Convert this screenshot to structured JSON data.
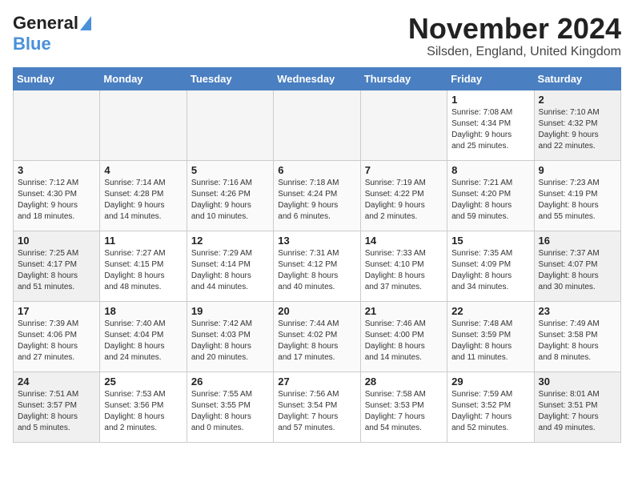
{
  "logo": {
    "line1": "General",
    "line2": "Blue"
  },
  "title": "November 2024",
  "location": "Silsden, England, United Kingdom",
  "days_of_week": [
    "Sunday",
    "Monday",
    "Tuesday",
    "Wednesday",
    "Thursday",
    "Friday",
    "Saturday"
  ],
  "weeks": [
    [
      {
        "day": "",
        "info": "",
        "empty": true
      },
      {
        "day": "",
        "info": "",
        "empty": true
      },
      {
        "day": "",
        "info": "",
        "empty": true
      },
      {
        "day": "",
        "info": "",
        "empty": true
      },
      {
        "day": "",
        "info": "",
        "empty": true
      },
      {
        "day": "1",
        "info": "Sunrise: 7:08 AM\nSunset: 4:34 PM\nDaylight: 9 hours\nand 25 minutes."
      },
      {
        "day": "2",
        "info": "Sunrise: 7:10 AM\nSunset: 4:32 PM\nDaylight: 9 hours\nand 22 minutes."
      }
    ],
    [
      {
        "day": "3",
        "info": "Sunrise: 7:12 AM\nSunset: 4:30 PM\nDaylight: 9 hours\nand 18 minutes."
      },
      {
        "day": "4",
        "info": "Sunrise: 7:14 AM\nSunset: 4:28 PM\nDaylight: 9 hours\nand 14 minutes."
      },
      {
        "day": "5",
        "info": "Sunrise: 7:16 AM\nSunset: 4:26 PM\nDaylight: 9 hours\nand 10 minutes."
      },
      {
        "day": "6",
        "info": "Sunrise: 7:18 AM\nSunset: 4:24 PM\nDaylight: 9 hours\nand 6 minutes."
      },
      {
        "day": "7",
        "info": "Sunrise: 7:19 AM\nSunset: 4:22 PM\nDaylight: 9 hours\nand 2 minutes."
      },
      {
        "day": "8",
        "info": "Sunrise: 7:21 AM\nSunset: 4:20 PM\nDaylight: 8 hours\nand 59 minutes."
      },
      {
        "day": "9",
        "info": "Sunrise: 7:23 AM\nSunset: 4:19 PM\nDaylight: 8 hours\nand 55 minutes."
      }
    ],
    [
      {
        "day": "10",
        "info": "Sunrise: 7:25 AM\nSunset: 4:17 PM\nDaylight: 8 hours\nand 51 minutes."
      },
      {
        "day": "11",
        "info": "Sunrise: 7:27 AM\nSunset: 4:15 PM\nDaylight: 8 hours\nand 48 minutes."
      },
      {
        "day": "12",
        "info": "Sunrise: 7:29 AM\nSunset: 4:14 PM\nDaylight: 8 hours\nand 44 minutes."
      },
      {
        "day": "13",
        "info": "Sunrise: 7:31 AM\nSunset: 4:12 PM\nDaylight: 8 hours\nand 40 minutes."
      },
      {
        "day": "14",
        "info": "Sunrise: 7:33 AM\nSunset: 4:10 PM\nDaylight: 8 hours\nand 37 minutes."
      },
      {
        "day": "15",
        "info": "Sunrise: 7:35 AM\nSunset: 4:09 PM\nDaylight: 8 hours\nand 34 minutes."
      },
      {
        "day": "16",
        "info": "Sunrise: 7:37 AM\nSunset: 4:07 PM\nDaylight: 8 hours\nand 30 minutes."
      }
    ],
    [
      {
        "day": "17",
        "info": "Sunrise: 7:39 AM\nSunset: 4:06 PM\nDaylight: 8 hours\nand 27 minutes."
      },
      {
        "day": "18",
        "info": "Sunrise: 7:40 AM\nSunset: 4:04 PM\nDaylight: 8 hours\nand 24 minutes."
      },
      {
        "day": "19",
        "info": "Sunrise: 7:42 AM\nSunset: 4:03 PM\nDaylight: 8 hours\nand 20 minutes."
      },
      {
        "day": "20",
        "info": "Sunrise: 7:44 AM\nSunset: 4:02 PM\nDaylight: 8 hours\nand 17 minutes."
      },
      {
        "day": "21",
        "info": "Sunrise: 7:46 AM\nSunset: 4:00 PM\nDaylight: 8 hours\nand 14 minutes."
      },
      {
        "day": "22",
        "info": "Sunrise: 7:48 AM\nSunset: 3:59 PM\nDaylight: 8 hours\nand 11 minutes."
      },
      {
        "day": "23",
        "info": "Sunrise: 7:49 AM\nSunset: 3:58 PM\nDaylight: 8 hours\nand 8 minutes."
      }
    ],
    [
      {
        "day": "24",
        "info": "Sunrise: 7:51 AM\nSunset: 3:57 PM\nDaylight: 8 hours\nand 5 minutes."
      },
      {
        "day": "25",
        "info": "Sunrise: 7:53 AM\nSunset: 3:56 PM\nDaylight: 8 hours\nand 2 minutes."
      },
      {
        "day": "26",
        "info": "Sunrise: 7:55 AM\nSunset: 3:55 PM\nDaylight: 8 hours\nand 0 minutes."
      },
      {
        "day": "27",
        "info": "Sunrise: 7:56 AM\nSunset: 3:54 PM\nDaylight: 7 hours\nand 57 minutes."
      },
      {
        "day": "28",
        "info": "Sunrise: 7:58 AM\nSunset: 3:53 PM\nDaylight: 7 hours\nand 54 minutes."
      },
      {
        "day": "29",
        "info": "Sunrise: 7:59 AM\nSunset: 3:52 PM\nDaylight: 7 hours\nand 52 minutes."
      },
      {
        "day": "30",
        "info": "Sunrise: 8:01 AM\nSunset: 3:51 PM\nDaylight: 7 hours\nand 49 minutes."
      }
    ]
  ]
}
